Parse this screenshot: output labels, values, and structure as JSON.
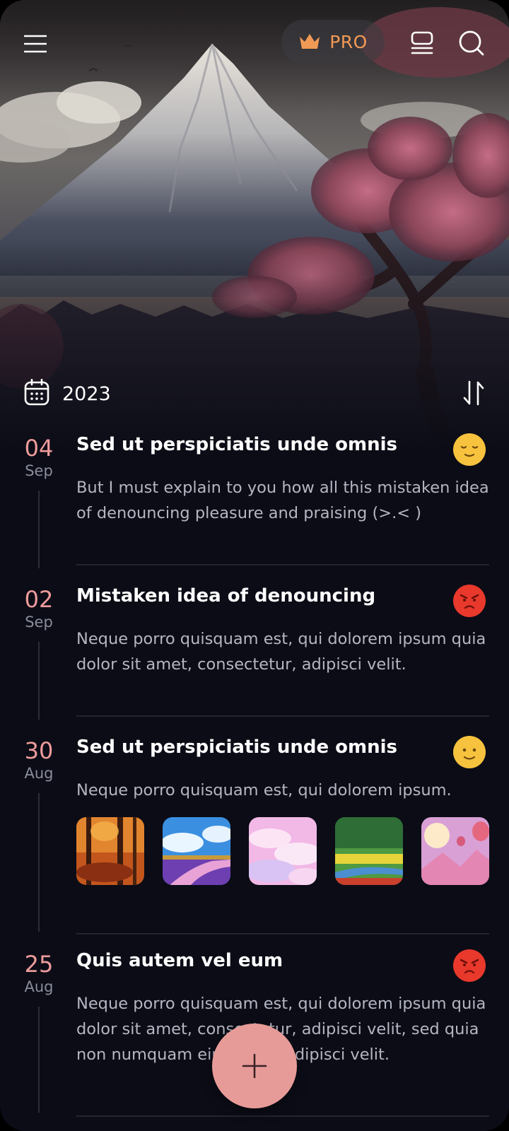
{
  "header": {
    "pro_label": "PRO",
    "icons": [
      "menu-icon",
      "crown-icon",
      "layout-icon",
      "search-icon"
    ]
  },
  "filter": {
    "year": "2023",
    "icons": [
      "calendar-icon",
      "sort-icon"
    ]
  },
  "colors": {
    "background": "#0b0c16",
    "date_accent": "#ef9c9c",
    "pro_accent": "#f19a55",
    "fab": "#e79b98"
  },
  "entries": [
    {
      "day": "04",
      "month": "Sep",
      "title": "Sed ut perspiciatis unde omnis",
      "body": "But I must explain to you how all this mistaken idea of denouncing pleasure and praising (>.< )",
      "mood": "content-face-icon"
    },
    {
      "day": "02",
      "month": "Sep",
      "title": "Mistaken idea of denouncing",
      "body": "Neque porro quisquam est, qui dolorem ipsum quia dolor sit amet, consectetur, adipisci velit.",
      "mood": "angry-face-icon"
    },
    {
      "day": "30",
      "month": "Aug",
      "title": "Sed ut perspiciatis unde omnis",
      "body": "Neque porro quisquam est, qui dolorem ipsum.",
      "mood": "smiling-face-icon",
      "photos": [
        "autumn-forest-photo",
        "sky-river-photo",
        "pink-clouds-photo",
        "green-meadow-photo",
        "balloon-sunset-photo"
      ]
    },
    {
      "day": "25",
      "month": "Aug",
      "title": "Quis autem vel eum",
      "body": "Neque porro quisquam est, qui dolorem ipsum quia dolor sit amet, consectetur, adipisci velit, sed quia non numquam eius modi, adipisci velit.",
      "mood": "angry-face-icon"
    }
  ],
  "fab": {
    "icon": "plus-icon"
  }
}
